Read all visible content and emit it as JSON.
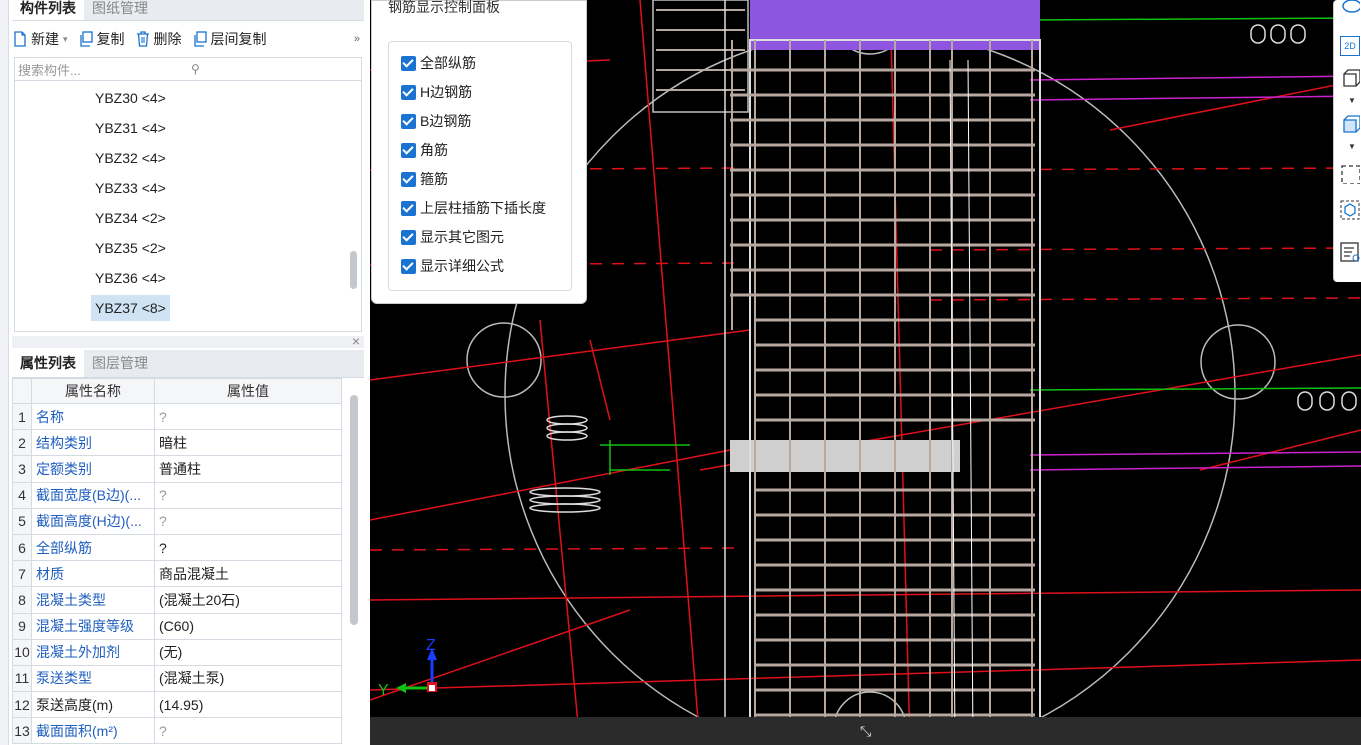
{
  "component_panel": {
    "tabs": [
      "构件列表",
      "图纸管理"
    ],
    "toolbar": {
      "new_label": "新建",
      "copy_label": "复制",
      "delete_label": "删除",
      "floor_copy_label": "层间复制",
      "more_label": "»"
    },
    "search_placeholder": "搜索构件...",
    "items": [
      {
        "label": "YBZ30 <4>"
      },
      {
        "label": "YBZ31 <4>"
      },
      {
        "label": "YBZ32 <4>"
      },
      {
        "label": "YBZ33 <4>"
      },
      {
        "label": "YBZ34 <2>"
      },
      {
        "label": "YBZ35 <2>"
      },
      {
        "label": "YBZ36 <4>"
      },
      {
        "label": "YBZ37 <8>"
      }
    ],
    "selected_item": "YBZ37 <8>"
  },
  "property_panel": {
    "tabs": [
      "属性列表",
      "图层管理"
    ],
    "columns": [
      "属性名称",
      "属性值"
    ],
    "rows": [
      {
        "num": "1",
        "name": "名称",
        "value": "?"
      },
      {
        "num": "2",
        "name": "结构类别",
        "value": "暗柱"
      },
      {
        "num": "3",
        "name": "定额类别",
        "value": "普通柱"
      },
      {
        "num": "4",
        "name": "截面宽度(B边)(...",
        "value": "?"
      },
      {
        "num": "5",
        "name": "截面高度(H边)(...",
        "value": "?"
      },
      {
        "num": "6",
        "name": "全部纵筋",
        "value": "?"
      },
      {
        "num": "7",
        "name": "材质",
        "value": "商品混凝土"
      },
      {
        "num": "8",
        "name": "混凝土类型",
        "value": "(混凝土20石)"
      },
      {
        "num": "9",
        "name": "混凝土强度等级",
        "value": "(C60)"
      },
      {
        "num": "10",
        "name": "混凝土外加剂",
        "value": "(无)"
      },
      {
        "num": "11",
        "name": "泵送类型",
        "value": "(混凝土泵)"
      },
      {
        "num": "12",
        "name": "泵送高度(m)",
        "value": "(14.95)"
      },
      {
        "num": "13",
        "name": "截面面积(m²)",
        "value": "?"
      }
    ]
  },
  "rebar_panel": {
    "title": "钢筋显示控制面板",
    "options": [
      {
        "label": "全部纵筋",
        "checked": true
      },
      {
        "label": "H边钢筋",
        "checked": true
      },
      {
        "label": "B边钢筋",
        "checked": true
      },
      {
        "label": "角筋",
        "checked": true
      },
      {
        "label": "箍筋",
        "checked": true
      },
      {
        "label": "上层柱插筋下插长度",
        "checked": true
      },
      {
        "label": "显示其它图元",
        "checked": true
      },
      {
        "label": "显示详细公式",
        "checked": true
      }
    ]
  },
  "viewport": {
    "axis_y_label": "Y",
    "axis_z_label": "Z",
    "right_toolbar": {
      "view_2d_label": "2D"
    }
  },
  "colors": {
    "accent": "#1a73d0",
    "link_text": "#1f5fbf",
    "selected_bg": "#cfe3f5",
    "rebar": "#b8a9a0",
    "axis_red": "#e0101a",
    "axis_green": "#10c010",
    "highlight_purple": "#8e55e0"
  }
}
